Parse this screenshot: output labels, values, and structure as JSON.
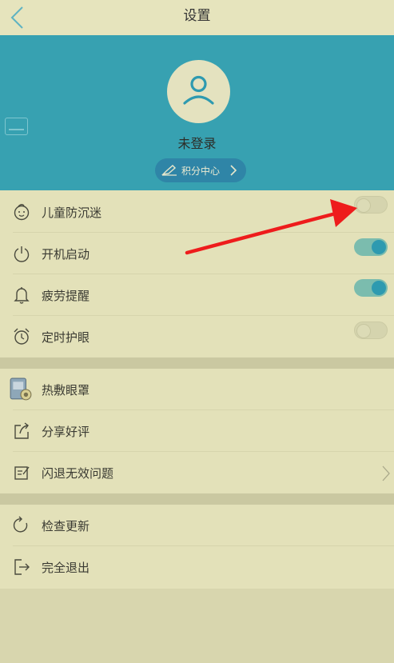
{
  "header": {
    "title": "设置",
    "back_icon": "chevron-left-icon"
  },
  "profile": {
    "avatar_icon": "user-icon",
    "login_status": "未登录",
    "points_button": {
      "icon": "pen-icon",
      "label": "积分中心",
      "chevron": "chevron-right-icon"
    }
  },
  "settings_group_1": [
    {
      "icon": "child-face-icon",
      "label": "儿童防沉迷",
      "toggle": "off"
    },
    {
      "icon": "power-icon",
      "label": "开机启动",
      "toggle": "on"
    },
    {
      "icon": "bell-icon",
      "label": "疲劳提醒",
      "toggle": "on"
    },
    {
      "icon": "alarm-clock-icon",
      "label": "定时护眼",
      "toggle": "off"
    }
  ],
  "settings_group_2": [
    {
      "icon": "eye-mask-app-icon",
      "label": "热敷眼罩"
    },
    {
      "icon": "share-icon",
      "label": "分享好评"
    },
    {
      "icon": "feedback-icon",
      "label": "闪退无效问题",
      "chevron": "chevron-right-icon"
    }
  ],
  "settings_group_3": [
    {
      "icon": "refresh-icon",
      "label": "检查更新"
    },
    {
      "icon": "exit-icon",
      "label": "完全退出"
    }
  ],
  "colors": {
    "background": "#e3e1b9",
    "hero": "#37a1b1",
    "toggle_on": "#2e9ab0",
    "annotation_arrow": "#ee1c1c"
  }
}
